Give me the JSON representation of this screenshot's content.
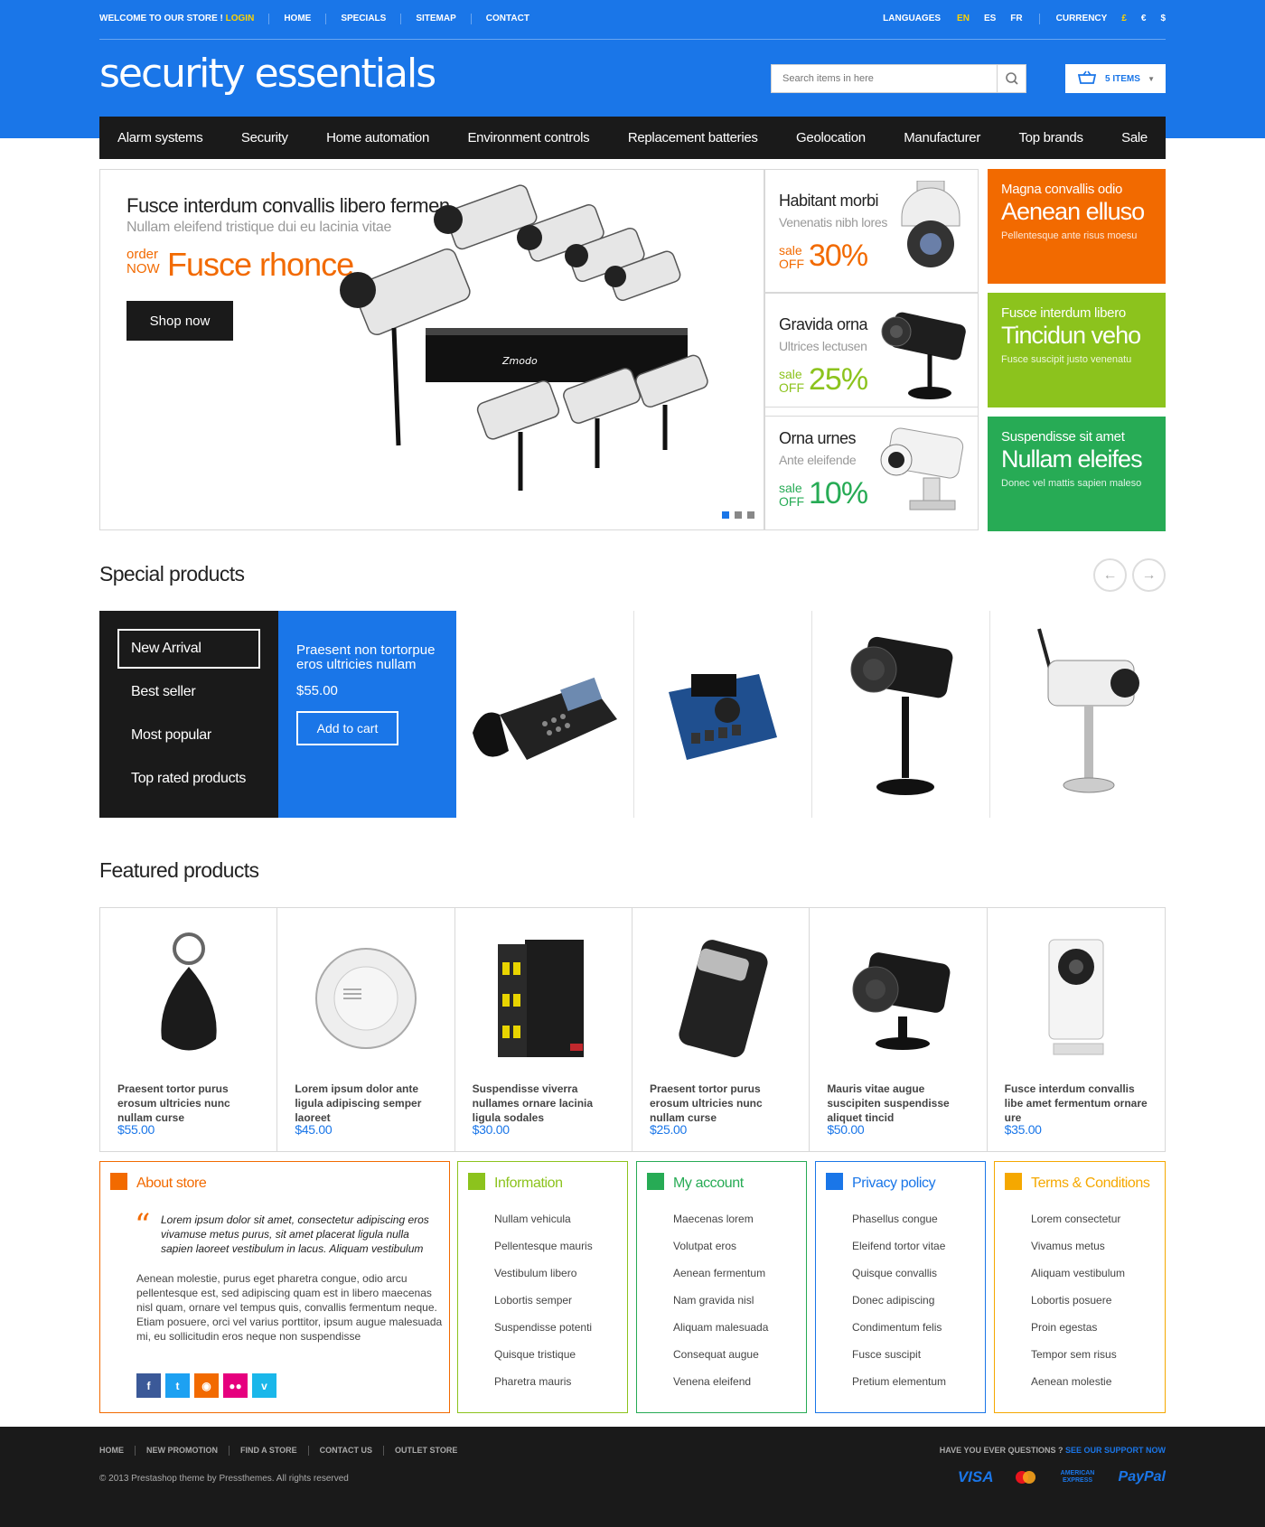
{
  "topbar": {
    "welcome": "Welcome to our store !",
    "login": "Login",
    "links": [
      "Home",
      "Specials",
      "Sitemap",
      "Contact"
    ],
    "languages_label": "Languages",
    "languages": [
      "EN",
      "ES",
      "FR"
    ],
    "currency_label": "Currency",
    "currencies": [
      "£",
      "€",
      "$"
    ]
  },
  "logo": "security essentials",
  "search": {
    "placeholder": "Search items in here"
  },
  "cart": {
    "label": "5 ITEMS"
  },
  "nav": [
    "Alarm systems",
    "Security",
    "Home automation",
    "Environment controls",
    "Replacement batteries",
    "Geolocation",
    "Manufacturer",
    "Top brands",
    "Sale"
  ],
  "slider": {
    "title": "Fusce interdum convallis libero fermen",
    "subtitle": "Nullam eleifend tristique dui eu lacinia vitae",
    "order1": "order",
    "order2": "NOW",
    "big": "Fusce rhonce",
    "button": "Shop now",
    "dots": 3,
    "active_dot": 0
  },
  "promos": [
    {
      "title": "Habitant morbi",
      "sub": "Venenatis nibh lores",
      "sale1": "sale",
      "sale2": "OFF",
      "pct": "30%",
      "color": "#f26a00"
    },
    {
      "title": "Gravida orna",
      "sub": "Ultrices lectusen",
      "sale1": "sale",
      "sale2": "OFF",
      "pct": "25%",
      "color": "#8cc31d"
    },
    {
      "title": "Orna urnes",
      "sub": "Ante eleifende",
      "sale1": "sale",
      "sale2": "OFF",
      "pct": "10%",
      "color": "#27ab55"
    }
  ],
  "tiles": [
    {
      "a": "Magna convallis odio",
      "b": "Aenean elluso",
      "c": "Pellentesque ante risus moesu",
      "color": "#f26a00"
    },
    {
      "a": "Fusce interdum libero",
      "b": "Tincidun veho",
      "c": "Fusce suscipit justo venenatu",
      "color": "#8cc31d"
    },
    {
      "a": "Suspendisse sit amet",
      "b": "Nullam eleifes",
      "c": "Donec vel mattis sapien maleso",
      "color": "#27ab55"
    }
  ],
  "special": {
    "heading": "Special products",
    "tabs": [
      "New Arrival",
      "Best seller",
      "Most popular",
      "Top rated products"
    ],
    "active_tab": 0,
    "highlight": {
      "name": "Praesent non tortorpue eros ultricies nullam",
      "price": "$55.00",
      "button": "Add to cart"
    }
  },
  "featured": {
    "heading": "Featured products",
    "items": [
      {
        "name": "Praesent tortor purus erosum ultricies nunc nullam curse",
        "price": "$55.00"
      },
      {
        "name": "Lorem ipsum dolor ante ligula adipiscing semper laoreet",
        "price": "$45.00"
      },
      {
        "name": "Suspendisse viverra nullames ornare lacinia ligula sodales",
        "price": "$30.00"
      },
      {
        "name": "Praesent tortor purus erosum ultricies nunc nullam curse",
        "price": "$25.00"
      },
      {
        "name": "Mauris vitae augue suscipiten suspendisse aliquet tincid",
        "price": "$50.00"
      },
      {
        "name": "Fusce interdum convallis libe amet fermentum ornare ure",
        "price": "$35.00"
      }
    ]
  },
  "about": {
    "title": "About store",
    "quote": "Lorem ipsum dolor sit amet, consectetur adipiscing eros vivamuse metus purus, sit amet placerat ligula nulla sapien laoreet vestibulum in lacus. Aliquam vestibulum",
    "text": "Aenean molestie, purus eget pharetra congue, odio arcu pellentesque est, sed adipiscing quam est in libero maecenas nisl quam, ornare vel tempus quis, convallis fermentum neque. Etiam posuere, orci vel varius porttitor, ipsum augue malesuada mi, eu sollicitudin eros neque non suspendisse",
    "color": "#f26a00"
  },
  "cols": [
    {
      "title": "Information",
      "color": "#8cc31d",
      "items": [
        "Nullam vehicula",
        "Pellentesque mauris",
        "Vestibulum libero",
        "Lobortis semper",
        "Suspendisse potenti",
        "Quisque tristique",
        "Pharetra mauris"
      ]
    },
    {
      "title": "My account",
      "color": "#27ab55",
      "items": [
        "Maecenas lorem",
        "Volutpat eros",
        "Aenean fermentum",
        "Nam gravida nisl",
        "Aliquam malesuada",
        "Consequat augue",
        "Venena eleifend"
      ]
    },
    {
      "title": "Privacy policy",
      "color": "#1a76e8",
      "items": [
        "Phasellus congue",
        "Eleifend tortor vitae",
        "Quisque convallis",
        "Donec adipiscing",
        "Condimentum felis",
        "Fusce suscipit",
        "Pretium elementum"
      ]
    },
    {
      "title": "Terms & Conditions",
      "color": "#f5a800",
      "items": [
        "Lorem consectetur",
        "Vivamus metus",
        "Aliquam vestibulum",
        "Lobortis posuere",
        "Proin egestas",
        "Tempor sem risus",
        "Aenean molestie"
      ]
    }
  ],
  "bottom": {
    "links": [
      "Home",
      "New promotion",
      "Find a store",
      "Contact us",
      "Outlet store"
    ],
    "copyright": "© 2013 Prestashop theme by Pressthemes. All rights reserved",
    "question": "Have you ever questions ?",
    "support": "See our support now",
    "payments": [
      "VISA",
      "MasterCard",
      "AMERICAN EXPRESS",
      "PayPal"
    ]
  }
}
